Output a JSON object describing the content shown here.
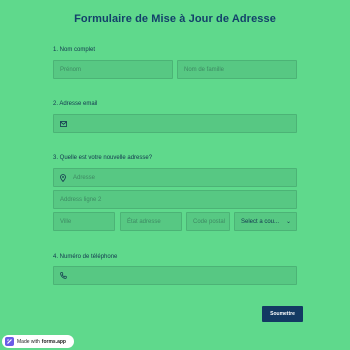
{
  "form": {
    "title": "Formulaire de Mise à Jour de Adresse",
    "q1": {
      "label": "1.  Nom complet",
      "first_placeholder": "Prénom",
      "last_placeholder": "Nom de famille"
    },
    "q2": {
      "label": "2.  Adresse email",
      "icon": "envelope-icon"
    },
    "q3": {
      "label": "3.  Quelle est votre nouvelle adresse?",
      "address1_placeholder": "Adresse",
      "address1_icon": "location-pin-icon",
      "address2_placeholder": "Address ligne 2",
      "city_placeholder": "Ville",
      "state_placeholder": "État adresse",
      "zip_placeholder": "Code postal",
      "country_value": "Select a cou..."
    },
    "q4": {
      "label": "4.  Numéro de téléphone",
      "icon": "phone-icon"
    },
    "submit_label": "Soumettre"
  },
  "badge": {
    "prefix": "Made with",
    "brand": "forms.app"
  },
  "colors": {
    "background": "#5fd98c",
    "field": "#57c883",
    "button": "#133a63",
    "title": "#13406a"
  }
}
